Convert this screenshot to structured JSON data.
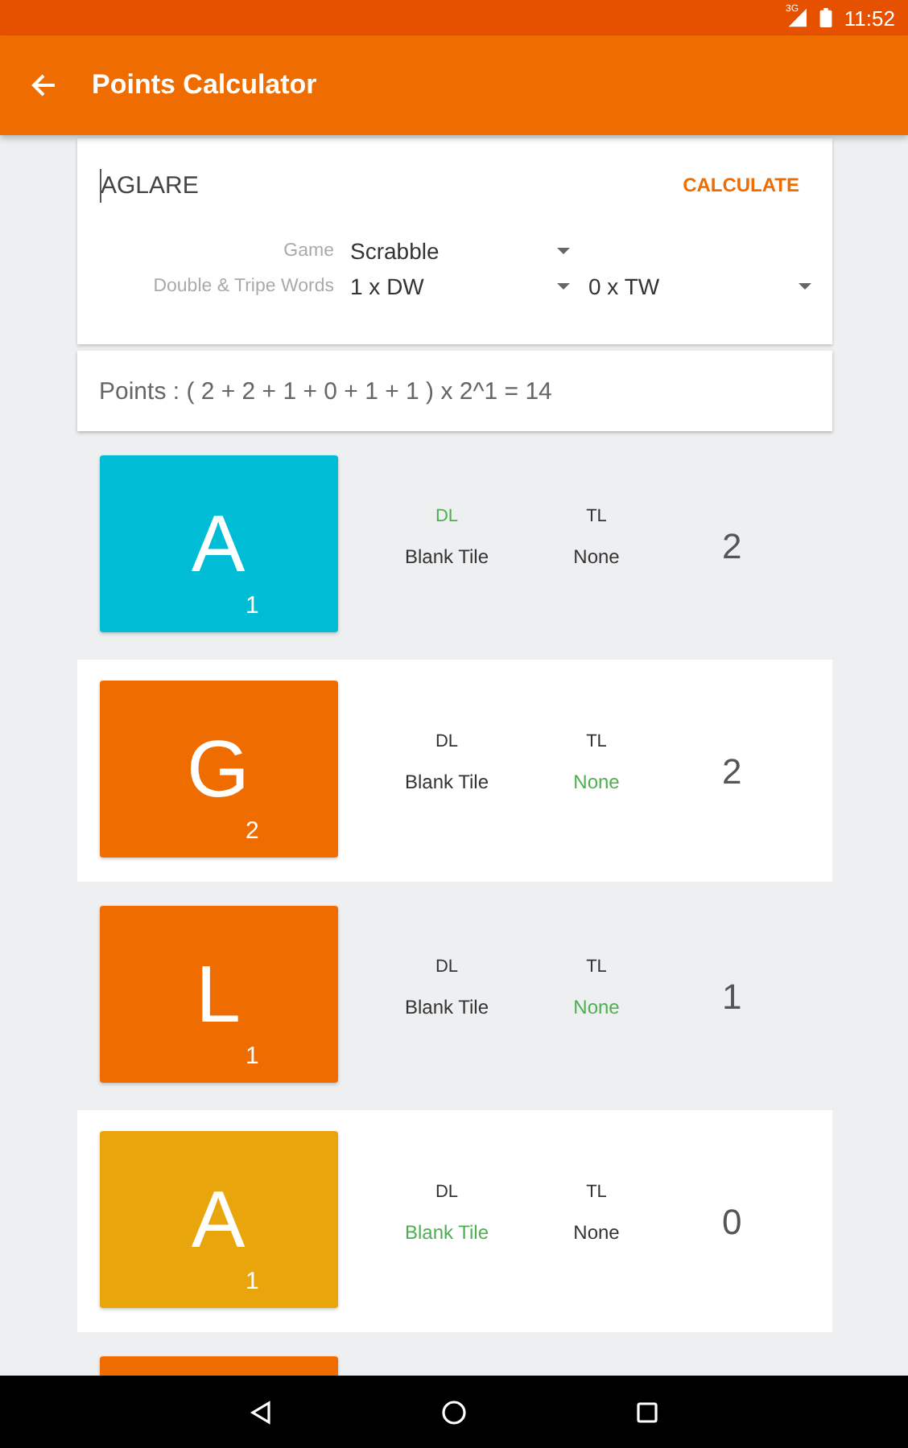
{
  "status_bar": {
    "network": "3G",
    "time": "11:52"
  },
  "app_bar": {
    "title": "Points Calculator"
  },
  "word_field": {
    "value": "AGLARE"
  },
  "calculate_button": "CALCULATE",
  "game": {
    "label": "Game",
    "value": "Scrabble"
  },
  "multipliers": {
    "label": "Double & Tripe Words",
    "double": "1 x DW",
    "triple": "0 x TW"
  },
  "points": "Points : ( 2 + 2 + 1 + 0 + 1 + 1 )  x 2^1 = 14",
  "tiles": [
    {
      "letter": "A",
      "value": "1",
      "color": "#00bcd4",
      "selected": false,
      "dl": {
        "label": "DL",
        "selected": true
      },
      "tl": {
        "label": "TL",
        "selected": false
      },
      "blank": {
        "label": "Blank Tile",
        "selected": false
      },
      "none": {
        "label": "None",
        "selected": false
      },
      "score": "2"
    },
    {
      "letter": "G",
      "value": "2",
      "color": "#ef6c00",
      "selected": true,
      "dl": {
        "label": "DL",
        "selected": false
      },
      "tl": {
        "label": "TL",
        "selected": false
      },
      "blank": {
        "label": "Blank Tile",
        "selected": false
      },
      "none": {
        "label": "None",
        "selected": true
      },
      "score": "2"
    },
    {
      "letter": "L",
      "value": "1",
      "color": "#ef6c00",
      "selected": false,
      "dl": {
        "label": "DL",
        "selected": false
      },
      "tl": {
        "label": "TL",
        "selected": false
      },
      "blank": {
        "label": "Blank Tile",
        "selected": false
      },
      "none": {
        "label": "None",
        "selected": true
      },
      "score": "1"
    },
    {
      "letter": "A",
      "value": "1",
      "color": "#e8a50c",
      "selected": true,
      "dl": {
        "label": "DL",
        "selected": false
      },
      "tl": {
        "label": "TL",
        "selected": false
      },
      "blank": {
        "label": "Blank Tile",
        "selected": true
      },
      "none": {
        "label": "None",
        "selected": false
      },
      "score": "0"
    }
  ],
  "next_tile": {
    "color": "#ef6c00"
  }
}
